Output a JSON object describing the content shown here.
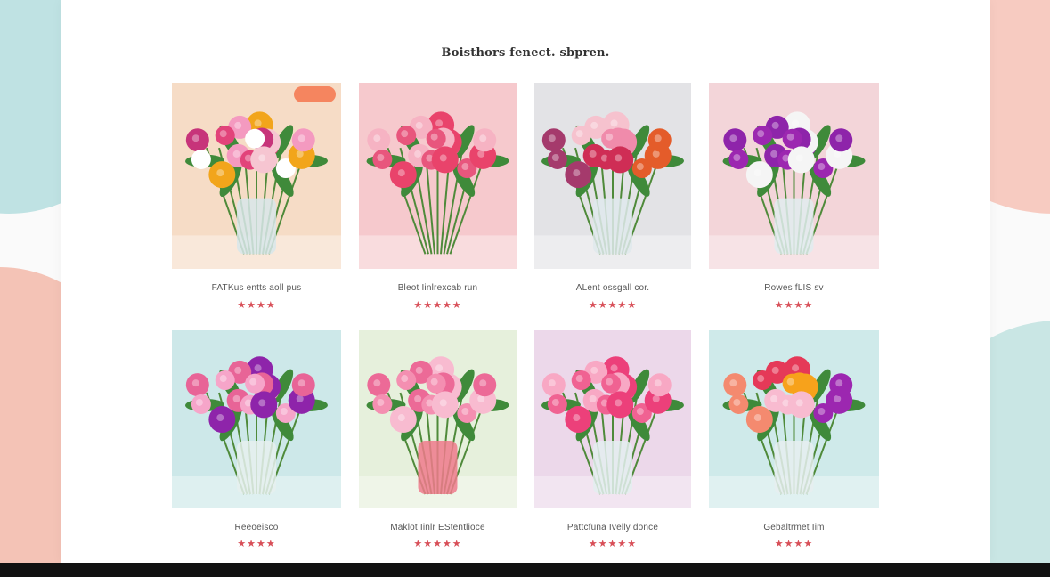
{
  "heading": "Boisthors fenect. sbpren.",
  "products": [
    {
      "name": "FATKus entts aoll pus",
      "stars": "★★★★",
      "badge": "",
      "bg": "#f6dcc6",
      "vase": "#d8e6ea",
      "flowers": [
        "#e2437a",
        "#f49ac0",
        "#f2a51b",
        "#ffffff",
        "#c7347a",
        "#f6c5d1"
      ]
    },
    {
      "name": "Bleot Iinlrexcab run",
      "stars": "★★★★★",
      "bg": "#f6c9cd",
      "vase": "",
      "flowers": [
        "#e8567d",
        "#f6b3c3",
        "#e9436b"
      ]
    },
    {
      "name": "ALent ossgall cor.",
      "stars": "★★★★★",
      "bg": "#e3e3e6",
      "vase": "#dfe9ec",
      "flowers": [
        "#f08bab",
        "#cf2d55",
        "#f6c2ce",
        "#e45c2a",
        "#a53a6c"
      ]
    },
    {
      "name": "Rowes fLIS sv",
      "stars": "★★★★",
      "bg": "#f3d5d9",
      "vase": "#e1ecee",
      "flowers": [
        "#9c27b0",
        "#8e24aa",
        "#f5f5f5"
      ]
    },
    {
      "name": "Reeoeisco",
      "stars": "★★★★",
      "bg": "#cde8e9",
      "vase": "#e6f0ef",
      "flowers": [
        "#f6a5c9",
        "#e86497",
        "#8e24aa"
      ]
    },
    {
      "name": "Maklot Iinlr EStentlioce",
      "stars": "★★★★★",
      "bg": "#e6f0dc",
      "vase": "#ee7a8c",
      "flowers": [
        "#f48fb1",
        "#ec6a97",
        "#f8bbd0"
      ]
    },
    {
      "name": "Pattcfuna Ivelly donce",
      "stars": "★★★★★",
      "bg": "#ecd8ea",
      "vase": "#e4eef0",
      "flowers": [
        "#f06292",
        "#f8a8c4",
        "#ec407a"
      ]
    },
    {
      "name": "Gebaltrmet Iim",
      "stars": "★★★★",
      "bg": "#cfeaea",
      "vase": "#e6eef0",
      "flowers": [
        "#f7a21b",
        "#f8bbd0",
        "#e53958",
        "#9c27b0",
        "#f48a6f"
      ]
    }
  ],
  "colors": {
    "accent_star": "#d84f58",
    "badge": "#f5855f"
  }
}
